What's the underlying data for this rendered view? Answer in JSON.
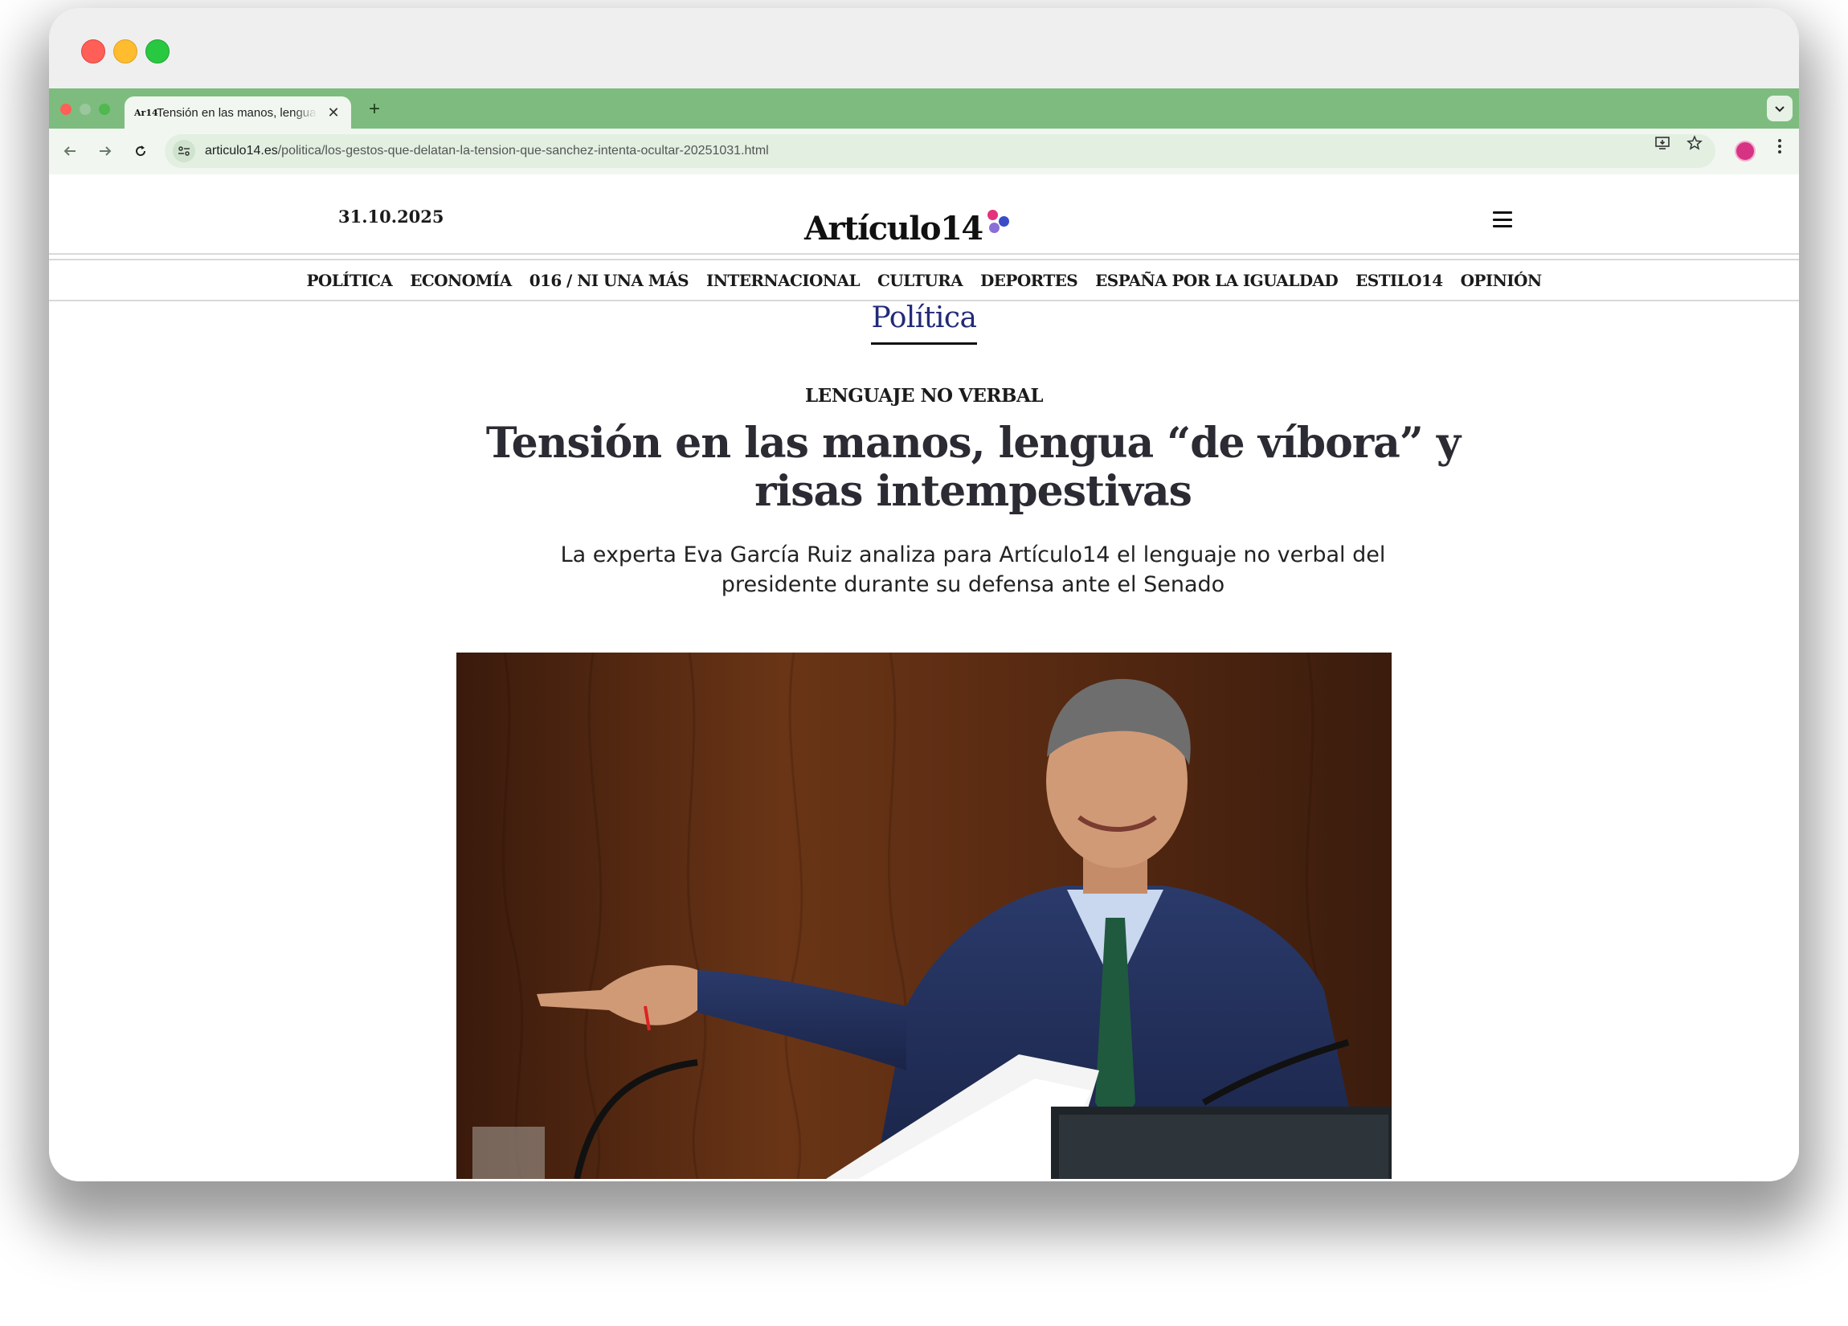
{
  "browser": {
    "tab_title": "Tensión en las manos, lengua",
    "tab_favicon": "Ar14",
    "new_tab_icon": "+",
    "close_icon": "✕",
    "url_host": "articulo14.es",
    "url_path": "/politica/los-gestos-que-delatan-la-tension-que-sanchez-intenta-ocultar-20251031.html",
    "accent_color": "#7dbc7e"
  },
  "site": {
    "date": "31.10.2025",
    "logo_text": "Artículo14",
    "logo_colors": [
      "#e4337a",
      "#3a4cc6",
      "#8a6fd6"
    ],
    "nav": [
      "POLÍTICA",
      "ECONOMÍA",
      "016 / NI UNA MÁS",
      "INTERNACIONAL",
      "CULTURA",
      "DEPORTES",
      "ESPAÑA POR LA IGUALDAD",
      "ESTILO14",
      "OPINIÓN"
    ]
  },
  "article": {
    "section": "Política",
    "kicker": "LENGUAJE NO VERBAL",
    "headline": "Tensión en las manos, lengua “de víbora” y risas intempestivas",
    "subtitle": "La experta Eva García Ruiz analiza para Artículo14 el lenguaje no verbal del presidente durante su defensa ante el Senado",
    "section_color": "#222a78"
  }
}
